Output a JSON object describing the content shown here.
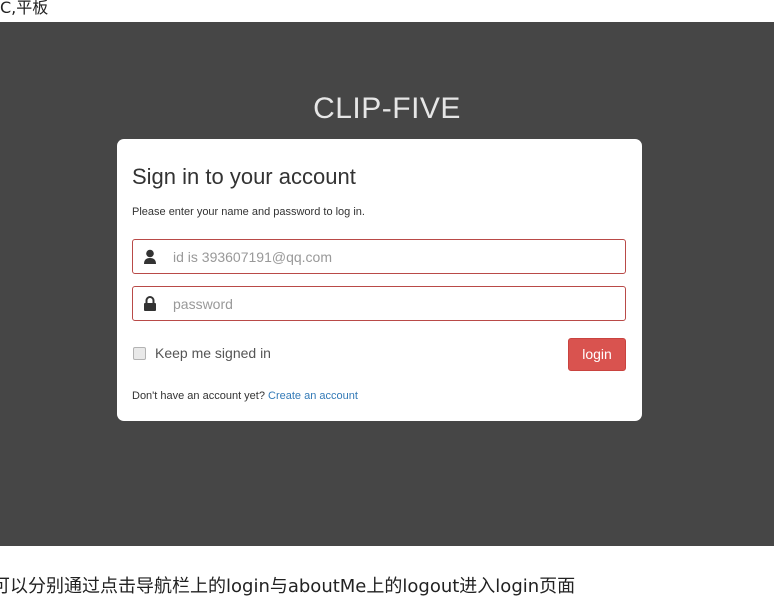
{
  "top_text": "C,平板",
  "brand": "CLIP-FIVE",
  "card": {
    "title": "Sign in to your account",
    "subtitle": "Please enter your name and password to log in."
  },
  "username": {
    "placeholder": "id is 393607191@qq.com",
    "value": "",
    "icon": "user-icon"
  },
  "password": {
    "placeholder": "password",
    "value": "",
    "icon": "lock-icon"
  },
  "remember": {
    "label": "Keep me signed in",
    "checked": false
  },
  "login_label": "login",
  "signup": {
    "prompt": "Don't have an account yet? ",
    "link_text": "Create an account"
  },
  "bottom_text": "可以分别通过点击导航栏上的login与aboutMe上的logout进入login页面",
  "colors": {
    "panel_bg": "#464646",
    "accent": "#d9534f",
    "field_border": "#b94a48",
    "link": "#337ab7"
  }
}
